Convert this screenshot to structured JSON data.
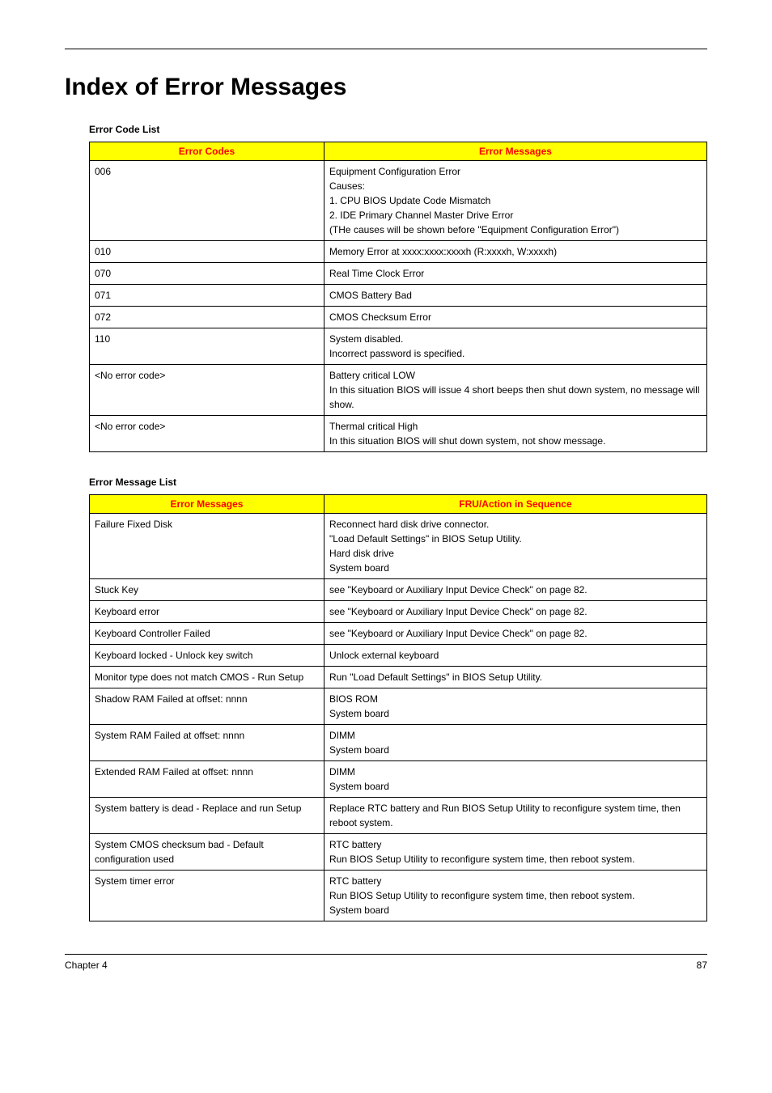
{
  "heading": "Index of Error Messages",
  "table1": {
    "title": "Error Code List",
    "headers": [
      "Error Codes",
      "Error Messages"
    ],
    "rows": [
      {
        "code": "006",
        "msg": "Equipment Configuration Error\nCauses:\n1. CPU BIOS Update Code Mismatch\n2. IDE Primary Channel Master Drive Error\n(THe causes will be shown before \"Equipment Configuration Error\")"
      },
      {
        "code": "010",
        "msg": "Memory Error at xxxx:xxxx:xxxxh (R:xxxxh, W:xxxxh)"
      },
      {
        "code": "070",
        "msg": "Real Time Clock Error"
      },
      {
        "code": "071",
        "msg": "CMOS Battery Bad"
      },
      {
        "code": "072",
        "msg": "CMOS Checksum Error"
      },
      {
        "code": "110",
        "msg": "System disabled.\nIncorrect password is specified."
      },
      {
        "code": "<No error code>",
        "msg": "Battery critical LOW\nIn this situation BIOS will issue 4 short beeps then shut down system, no message will show."
      },
      {
        "code": "<No error code>",
        "msg": "Thermal critical High\nIn this situation BIOS will shut down system, not show message."
      }
    ]
  },
  "table2": {
    "title": "Error Message List",
    "headers": [
      "Error Messages",
      "FRU/Action in Sequence"
    ],
    "rows": [
      {
        "msg": "Failure Fixed Disk",
        "action": "Reconnect hard disk drive connector.\n\"Load Default Settings\" in BIOS Setup Utility.\nHard disk drive\nSystem board"
      },
      {
        "msg": "Stuck Key",
        "action": "see \"Keyboard or Auxiliary Input Device Check\" on page 82."
      },
      {
        "msg": "Keyboard error",
        "action": "see \"Keyboard or Auxiliary Input Device Check\" on page 82."
      },
      {
        "msg": "Keyboard Controller Failed",
        "action": "see \"Keyboard or Auxiliary Input Device Check\" on page 82."
      },
      {
        "msg": "Keyboard locked - Unlock key switch",
        "action": "Unlock external keyboard"
      },
      {
        "msg": "Monitor type does not match CMOS - Run Setup",
        "action": "Run \"Load Default Settings\" in BIOS Setup Utility."
      },
      {
        "msg": "Shadow RAM Failed at offset: nnnn",
        "action": "BIOS ROM\nSystem board"
      },
      {
        "msg": "System RAM Failed at offset: nnnn",
        "action": "DIMM\nSystem board"
      },
      {
        "msg": "Extended RAM Failed at offset: nnnn",
        "action": "DIMM\nSystem board"
      },
      {
        "msg": "System battery is dead - Replace and run Setup",
        "action": "Replace RTC battery and Run BIOS Setup Utility to reconfigure system time, then reboot system."
      },
      {
        "msg": "System CMOS checksum bad - Default configuration used",
        "action": "RTC battery\nRun BIOS Setup Utility to reconfigure system time, then reboot system."
      },
      {
        "msg": "System timer error",
        "action": "RTC battery\nRun BIOS Setup Utility to reconfigure system time, then reboot system.\nSystem board"
      }
    ]
  },
  "footer": {
    "left": "Chapter 4",
    "right": "87"
  }
}
